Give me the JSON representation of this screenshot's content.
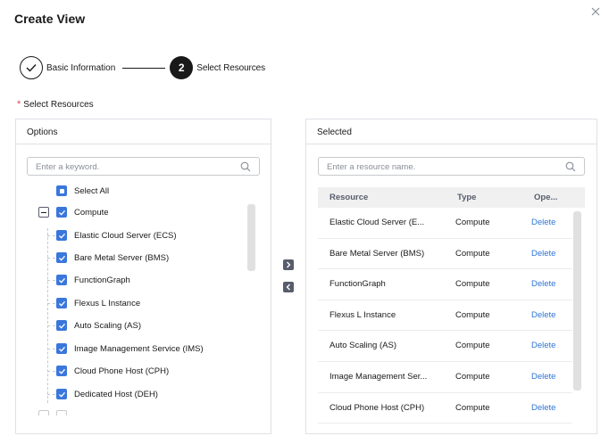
{
  "dialog": {
    "title": "Create View"
  },
  "steps": [
    {
      "label": "Basic Information",
      "state": "done"
    },
    {
      "number": "2",
      "label": "Select Resources",
      "state": "active"
    }
  ],
  "section_label": "Select Resources",
  "required_mark": "*",
  "options_panel": {
    "header": "Options",
    "search_placeholder": "Enter a keyword.",
    "tree": [
      {
        "label": "Select All",
        "state": "indeterminate"
      },
      {
        "label": "Compute",
        "state": "checked",
        "expanded": true
      },
      {
        "label": "Elastic Cloud Server (ECS)",
        "state": "checked"
      },
      {
        "label": "Bare Metal Server (BMS)",
        "state": "checked"
      },
      {
        "label": "FunctionGraph",
        "state": "checked"
      },
      {
        "label": "Flexus L Instance",
        "state": "checked"
      },
      {
        "label": "Auto Scaling (AS)",
        "state": "checked"
      },
      {
        "label": "Image Management Service (IMS)",
        "state": "checked"
      },
      {
        "label": "Cloud Phone Host (CPH)",
        "state": "checked"
      },
      {
        "label": "Dedicated Host (DEH)",
        "state": "checked"
      }
    ]
  },
  "selected_panel": {
    "header": "Selected",
    "search_placeholder": "Enter a resource name.",
    "columns": [
      "Resource",
      "Type",
      "Ope..."
    ],
    "rows": [
      {
        "resource": "Elastic Cloud Server (E...",
        "type": "Compute",
        "action": "Delete"
      },
      {
        "resource": "Bare Metal Server (BMS)",
        "type": "Compute",
        "action": "Delete"
      },
      {
        "resource": "FunctionGraph",
        "type": "Compute",
        "action": "Delete"
      },
      {
        "resource": "Flexus L Instance",
        "type": "Compute",
        "action": "Delete"
      },
      {
        "resource": "Auto Scaling (AS)",
        "type": "Compute",
        "action": "Delete"
      },
      {
        "resource": "Image Management Ser...",
        "type": "Compute",
        "action": "Delete"
      },
      {
        "resource": "Cloud Phone Host (CPH)",
        "type": "Compute",
        "action": "Delete"
      }
    ]
  },
  "colors": {
    "accent": "#3a77dc",
    "link": "#2e75d6",
    "required": "#e54545"
  }
}
